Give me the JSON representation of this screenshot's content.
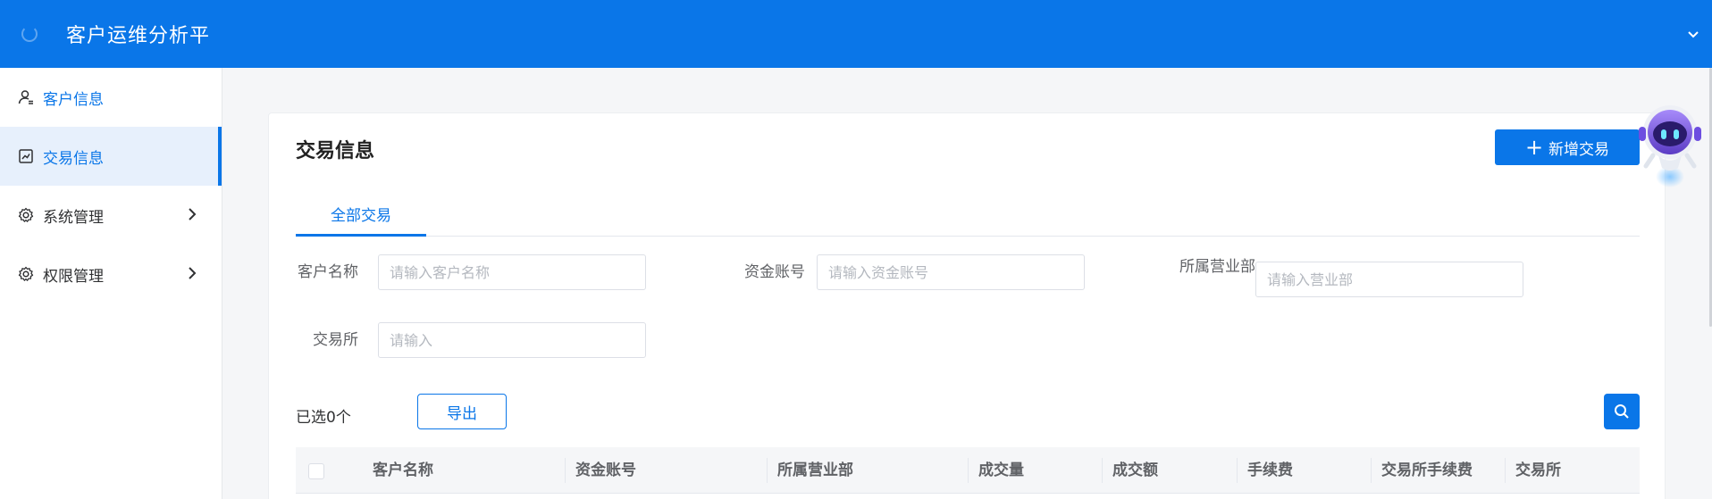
{
  "header": {
    "title": "客户运维分析平",
    "accent": "#0a76e8"
  },
  "sidebar": {
    "items": [
      {
        "label": "客户信息",
        "icon": "user-icon"
      },
      {
        "label": "交易信息",
        "icon": "chart-icon",
        "active": true
      },
      {
        "label": "系统管理",
        "icon": "gear-icon",
        "expandable": true
      },
      {
        "label": "权限管理",
        "icon": "gear-icon",
        "expandable": true
      }
    ]
  },
  "card": {
    "title": "交易信息",
    "add_button": "新增交易",
    "tabs": [
      {
        "label": "全部交易"
      }
    ]
  },
  "filters": {
    "customer_name": {
      "label": "客户名称",
      "placeholder": "请输入客户名称"
    },
    "fund_account": {
      "label": "资金账号",
      "placeholder": "请输入资金账号"
    },
    "branch": {
      "label": "所属营业部",
      "placeholder": "请输入营业部"
    },
    "exchange": {
      "label": "交易所",
      "placeholder": "请输入"
    }
  },
  "toolbar": {
    "selected_text": "已选0个",
    "export_label": "导出"
  },
  "table": {
    "columns": [
      "客户名称",
      "资金账号",
      "所属营业部",
      "成交量",
      "成交额",
      "手续费",
      "交易所手续费",
      "交易所"
    ]
  }
}
